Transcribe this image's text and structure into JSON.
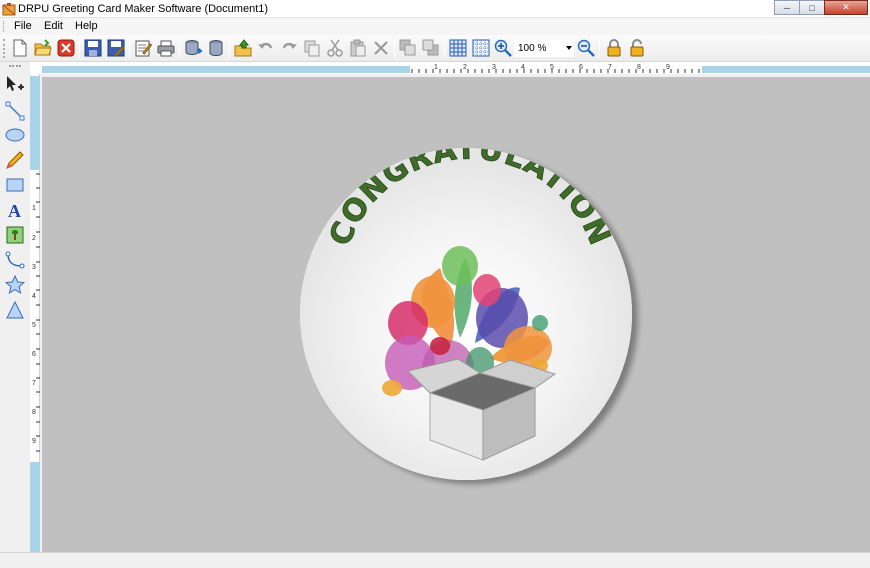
{
  "window": {
    "title": "DRPU Greeting Card Maker Software  (Document1)",
    "controls": [
      "minimize",
      "maximize",
      "close"
    ]
  },
  "menu": {
    "items": [
      {
        "label": "File"
      },
      {
        "label": "Edit"
      },
      {
        "label": "Help"
      }
    ]
  },
  "toolbar": {
    "zoom_value": "100 %",
    "icons": [
      "new-icon",
      "open-icon",
      "close-document-icon",
      "save-icon",
      "save-as-icon",
      "properties-icon",
      "print-icon",
      "database-add-icon",
      "database-icon",
      "import-icon",
      "undo-icon",
      "redo-icon",
      "copy-icon",
      "cut-icon",
      "paste-icon",
      "delete-icon",
      "bring-front-icon",
      "send-back-icon",
      "grid-icon",
      "grid-dotted-icon",
      "zoom-in-icon",
      "zoom-out-icon",
      "lock-icon",
      "unlock-icon"
    ]
  },
  "tools": {
    "items": [
      "select-move-icon",
      "line-icon",
      "ellipse-icon",
      "pencil-icon",
      "rectangle-icon",
      "text-icon",
      "image-icon",
      "curve-icon",
      "star-icon",
      "triangle-icon"
    ]
  },
  "rulers": {
    "horizontal_labels": [
      "1",
      "2",
      "3",
      "4",
      "5",
      "6",
      "7",
      "8",
      "9"
    ],
    "vertical_labels": [
      "1",
      "2",
      "3",
      "4",
      "5",
      "6",
      "7",
      "8",
      "9"
    ]
  },
  "card": {
    "headline": "CONGRATULATION",
    "headline_color": "#3f6b2b",
    "background": "#ffffff"
  },
  "colors": {
    "canvas_bg": "#c0c0c0",
    "ruler_accent": "#a9d3e6"
  }
}
